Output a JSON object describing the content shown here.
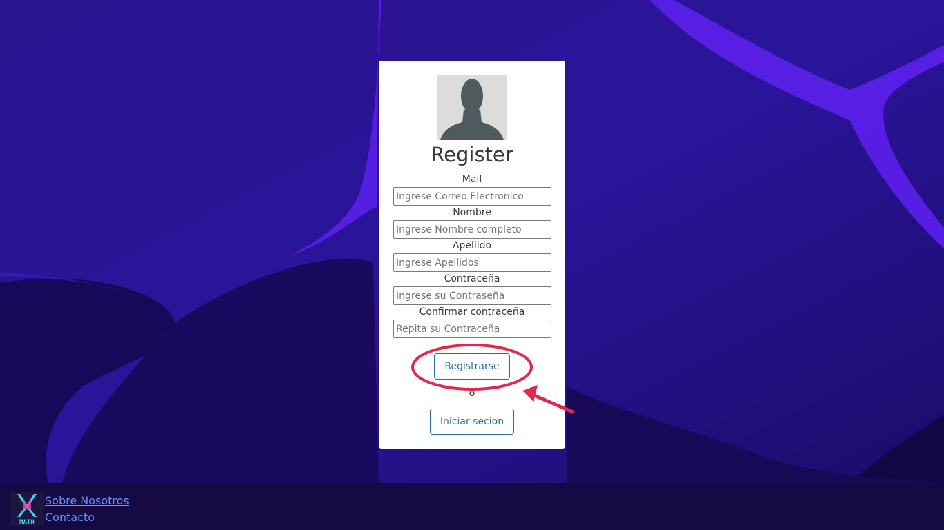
{
  "card": {
    "title": "Register",
    "fields": [
      {
        "label": "Mail",
        "placeholder": "Ingrese Correo Electronico"
      },
      {
        "label": "Nombre",
        "placeholder": "Ingrese Nombre completo"
      },
      {
        "label": "Apellido",
        "placeholder": "Ingrese Apellidos"
      },
      {
        "label": "Contraceña",
        "placeholder": "Ingrese su Contraseña"
      },
      {
        "label": "Confirmar contraceña",
        "placeholder": "Repita su Contraceña"
      }
    ],
    "register_label": "Registrarse",
    "separator": "o",
    "login_label": "Iniciar secion"
  },
  "footer": {
    "logo_text": "MATH",
    "links": [
      "Sobre Nosotros",
      "Contacto"
    ]
  },
  "colors": {
    "background": "#1e0d6e",
    "accent_stream": "#5a1fe8",
    "button_border": "#2c6f9e",
    "annotation": "#e0294d",
    "footer_bg": "#160a45",
    "link": "#6a8cff"
  }
}
